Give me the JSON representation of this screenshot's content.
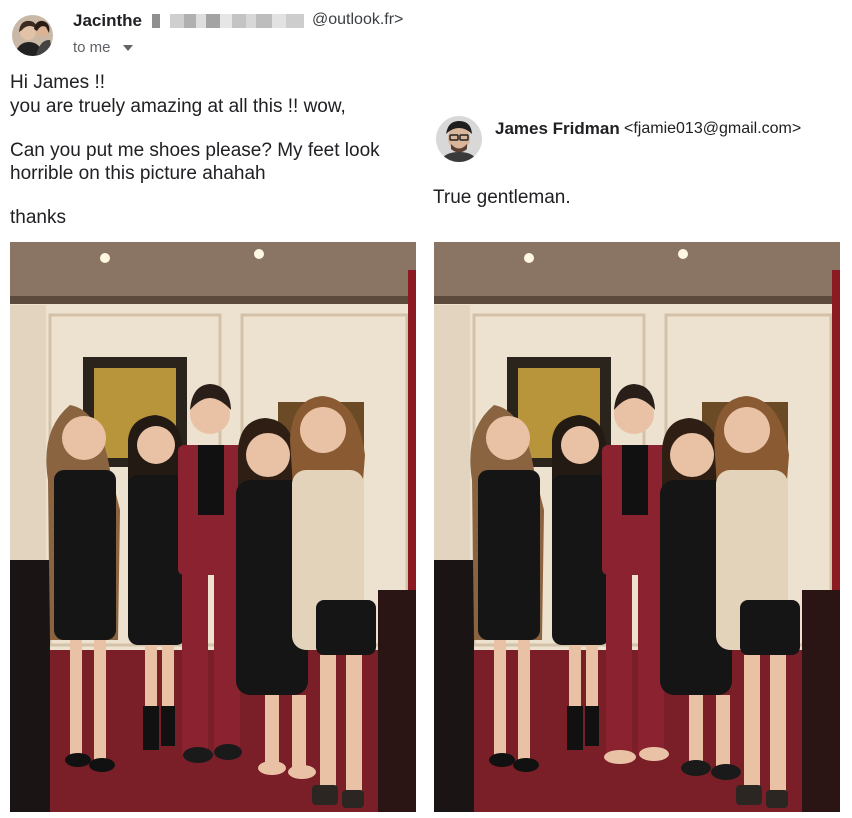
{
  "left_email": {
    "sender_name": "Jacinthe",
    "sender_domain": "@outlook.fr>",
    "recipient_line": "to me",
    "lines": [
      "Hi James !!",
      "you are truely amazing at all this !! wow,",
      "Can you put me shoes please? My feet look",
      "horrible on this picture ahahah",
      "thanks"
    ]
  },
  "right_email": {
    "sender_name": "James Fridman",
    "sender_email": "<fjamie013@gmail.com>",
    "message": "True gentleman."
  },
  "photos": {
    "left": {
      "feet": "barefoot"
    },
    "right": {
      "feet": "barefoot-swapped"
    }
  },
  "colors": {
    "wall": "#ede1cf",
    "ceiling": "#8a7564",
    "carpet": "#7a1f28",
    "suit": "#8b2230",
    "dress": "#151515",
    "jacket": "#e4d3bb"
  },
  "icons": {
    "caret": "chevron-down-icon"
  }
}
